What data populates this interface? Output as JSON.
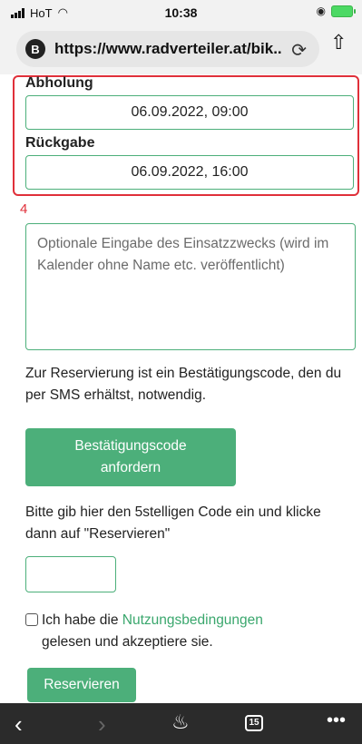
{
  "status_bar": {
    "carrier": "HoT",
    "time": "10:38"
  },
  "browser": {
    "site_badge": "B",
    "url": "https://www.radverteiler.at/bik...",
    "tab_count": "15"
  },
  "booking": {
    "pickup_label": "Abholung",
    "pickup_value": "06.09.2022, 09:00",
    "return_label": "Rückgabe",
    "return_value": "06.09.2022, 16:00"
  },
  "step_number": "4",
  "purpose": {
    "placeholder": "Optionale Eingabe des Einsatzzwecks (wird im Kalender ohne Name etc. veröffentlicht)"
  },
  "verification": {
    "info_text": "Zur Reservierung ist ein Bestätigungscode, den du per SMS erhältst, notwendig.",
    "request_button": "Bestätigungscode anfordern",
    "code_instruction": "Bitte gib hier den 5stelligen Code ein und klicke dann auf \"Reservieren\""
  },
  "terms": {
    "prefix": "Ich habe die",
    "link": "Nutzungsbedingungen",
    "suffix": "gelesen und akzeptiere sie."
  },
  "reserve_button": "Reservieren",
  "colors": {
    "accent": "#4caf7a",
    "highlight": "#e0303a",
    "toolbar": "#2b2b2b"
  }
}
